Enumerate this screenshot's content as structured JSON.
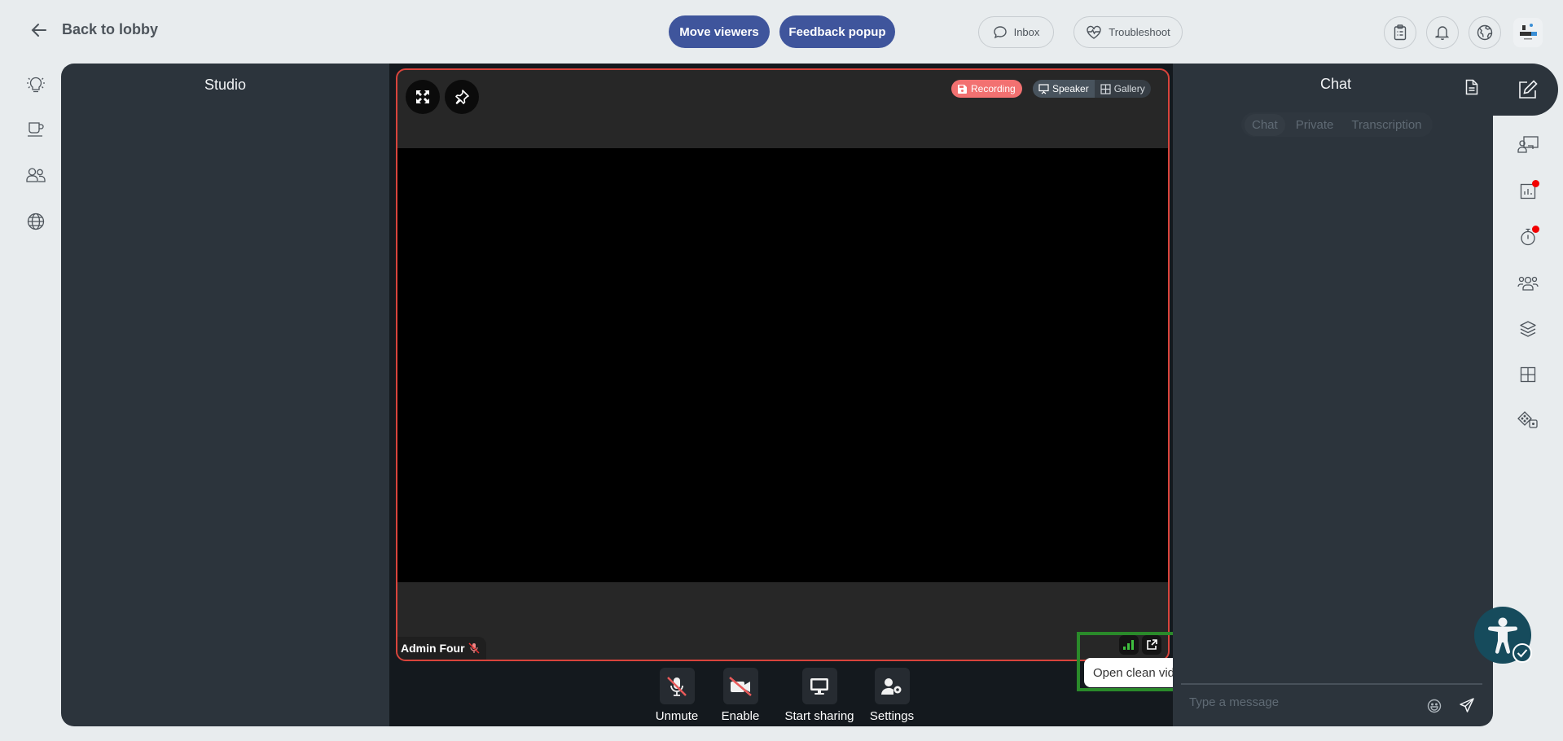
{
  "header": {
    "back_label": "Back to lobby",
    "move_viewers_label": "Move viewers",
    "feedback_popup_label": "Feedback popup",
    "inbox_label": "Inbox",
    "troubleshoot_label": "Troubleshoot"
  },
  "left_rail": {
    "items": [
      {
        "icon": "lightbulb-icon"
      },
      {
        "icon": "coffee-cup-icon"
      },
      {
        "icon": "users-icon"
      },
      {
        "icon": "globe-icon"
      }
    ]
  },
  "studio": {
    "title": "Studio"
  },
  "stage": {
    "recording_label": "Recording",
    "view_modes": [
      {
        "label": "Speaker",
        "active": true
      },
      {
        "label": "Gallery",
        "active": false
      }
    ],
    "participant_name": "Admin Four",
    "participant_muted": true,
    "tooltip": "Open clean video feed",
    "colors": {
      "frame_border": "#d9443c",
      "recording": "#f27171",
      "signal": "#3fbf3f",
      "highlight": "#2a8a2a"
    }
  },
  "controls": [
    {
      "label": "Unmute",
      "icon": "mic-off-icon"
    },
    {
      "label": "Enable",
      "icon": "camera-off-icon"
    },
    {
      "label": "Start sharing",
      "icon": "monitor-icon"
    },
    {
      "label": "Settings",
      "icon": "user-gear-icon"
    }
  ],
  "chat": {
    "title": "Chat",
    "tabs": [
      {
        "label": "Chat",
        "active": true
      },
      {
        "label": "Private",
        "active": false
      },
      {
        "label": "Transcription",
        "active": false
      }
    ],
    "input_placeholder": "Type a message"
  },
  "right_rail": {
    "items": [
      {
        "icon": "edit-icon",
        "badge": false
      },
      {
        "icon": "presenter-icon",
        "badge": false
      },
      {
        "icon": "poll-chart-icon",
        "badge": true
      },
      {
        "icon": "timer-icon",
        "badge": true
      },
      {
        "icon": "group-icon",
        "badge": false
      },
      {
        "icon": "layers-icon",
        "badge": false
      },
      {
        "icon": "grid-layout-icon",
        "badge": false
      },
      {
        "icon": "dice-icon",
        "badge": false
      }
    ]
  }
}
